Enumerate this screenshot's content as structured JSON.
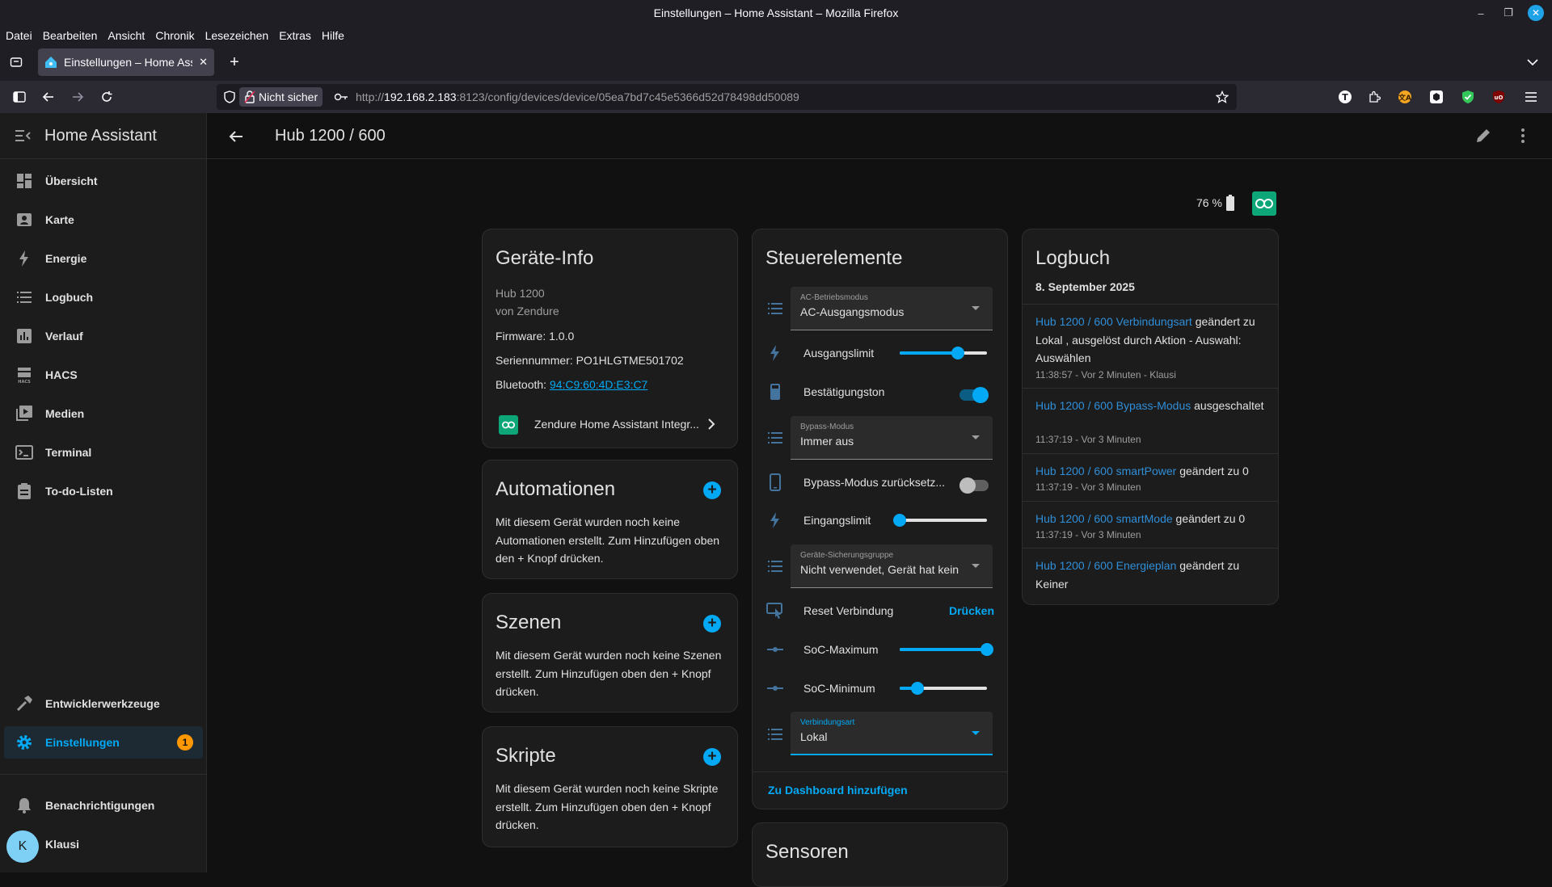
{
  "browser": {
    "window_title": "Einstellungen – Home Assistant – Mozilla Firefox",
    "menu": [
      "Datei",
      "Bearbeiten",
      "Ansicht",
      "Chronik",
      "Lesezeichen",
      "Extras",
      "Hilfe"
    ],
    "tab_title": "Einstellungen – Home Assist",
    "not_secure_label": "Nicht sicher",
    "url_prefix": "http://",
    "url_host": "192.168.2.183",
    "url_rest": ":8123/config/devices/device/05ea7bd7c45e5366d52d78498dd50089"
  },
  "sidebar": {
    "title": "Home Assistant",
    "items": [
      {
        "label": "Übersicht",
        "icon": "dashboard-icon"
      },
      {
        "label": "Karte",
        "icon": "map-icon"
      },
      {
        "label": "Energie",
        "icon": "lightning-icon"
      },
      {
        "label": "Logbuch",
        "icon": "list-icon"
      },
      {
        "label": "Verlauf",
        "icon": "chart-icon"
      },
      {
        "label": "HACS",
        "icon": "hacs-icon"
      },
      {
        "label": "Medien",
        "icon": "media-icon"
      },
      {
        "label": "Terminal",
        "icon": "terminal-icon"
      },
      {
        "label": "To-do-Listen",
        "icon": "clipboard-icon"
      }
    ],
    "dev_tools": "Entwicklerwerkzeuge",
    "settings": "Einstellungen",
    "settings_badge": "1",
    "notifications": "Benachrichtigungen",
    "user_initial": "K",
    "user_name": "Klausi"
  },
  "header": {
    "title": "Hub 1200 / 600"
  },
  "battery": {
    "level": "76 %"
  },
  "device_info": {
    "title": "Geräte-Info",
    "model": "Hub 1200",
    "manufacturer": "von Zendure",
    "firmware": "Firmware: 1.0.0",
    "serial": "Seriennummer: PO1HLGTME501702",
    "bluetooth_label": "Bluetooth: ",
    "bluetooth_value": "94:C9:60:4D:E3:C7",
    "integration": "Zendure Home Assistant Integr..."
  },
  "automations": {
    "title": "Automationen",
    "text": "Mit diesem Gerät wurden noch keine Automationen erstellt. Zum Hinzufügen oben den + Knopf drücken."
  },
  "scenes": {
    "title": "Szenen",
    "text": "Mit diesem Gerät wurden noch keine Szenen erstellt. Zum Hinzufügen oben den + Knopf drücken."
  },
  "scripts": {
    "title": "Skripte",
    "text": "Mit diesem Gerät wurden noch keine Skripte erstellt. Zum Hinzufügen oben den + Knopf drücken."
  },
  "controls": {
    "title": "Steuerelemente",
    "ac_mode_label": "AC-Betriebsmodus",
    "ac_mode_value": "AC-Ausgangsmodus",
    "output_limit": "Ausgangslimit",
    "output_limit_level": 0.67,
    "confirm_tone": "Bestätigungston",
    "confirm_tone_on": true,
    "bypass_label": "Bypass-Modus",
    "bypass_value": "Immer aus",
    "bypass_reset": "Bypass-Modus zurücksetz...",
    "bypass_reset_on": false,
    "input_limit": "Eingangslimit",
    "input_limit_level": 0.0,
    "backup_group_label": "Geräte-Sicherungsgruppe",
    "backup_group_value": "Nicht verwendet, Gerät hat kein",
    "reset_connection": "Reset Verbindung",
    "press_label": "Drücken",
    "soc_max": "SoC-Maximum",
    "soc_max_level": 1.0,
    "soc_min": "SoC-Minimum",
    "soc_min_level": 0.2,
    "connection_label": "Verbindungsart",
    "connection_value": "Lokal",
    "add_dashboard": "Zu Dashboard hinzufügen"
  },
  "sensors": {
    "title": "Sensoren"
  },
  "logbook": {
    "title": "Logbuch",
    "date": "8. September 2025",
    "entries": [
      {
        "entity": "Hub 1200 / 600 Verbindungsart",
        "text": " geändert zu Lokal , ausgelöst durch Aktion - Auswahl: Auswählen",
        "time": "11:38:57 - Vor 2 Minuten - Klausi"
      },
      {
        "entity": "Hub 1200 / 600 Bypass-Modus",
        "text": " ausgeschaltet",
        "time": "11:37:19 - Vor 3 Minuten"
      },
      {
        "entity": "Hub 1200 / 600 smartPower",
        "text": " geändert zu 0",
        "time": "11:37:19 - Vor 3 Minuten"
      },
      {
        "entity": "Hub 1200 / 600 smartMode",
        "text": " geändert zu 0",
        "time": "11:37:19 - Vor 3 Minuten"
      },
      {
        "entity": "Hub 1200 / 600 Energieplan",
        "text": " geändert zu Keiner",
        "time": ""
      }
    ]
  },
  "colors": {
    "accent": "#03a9f4",
    "badge": "#ff9800",
    "brand_green": "#0ca678"
  }
}
